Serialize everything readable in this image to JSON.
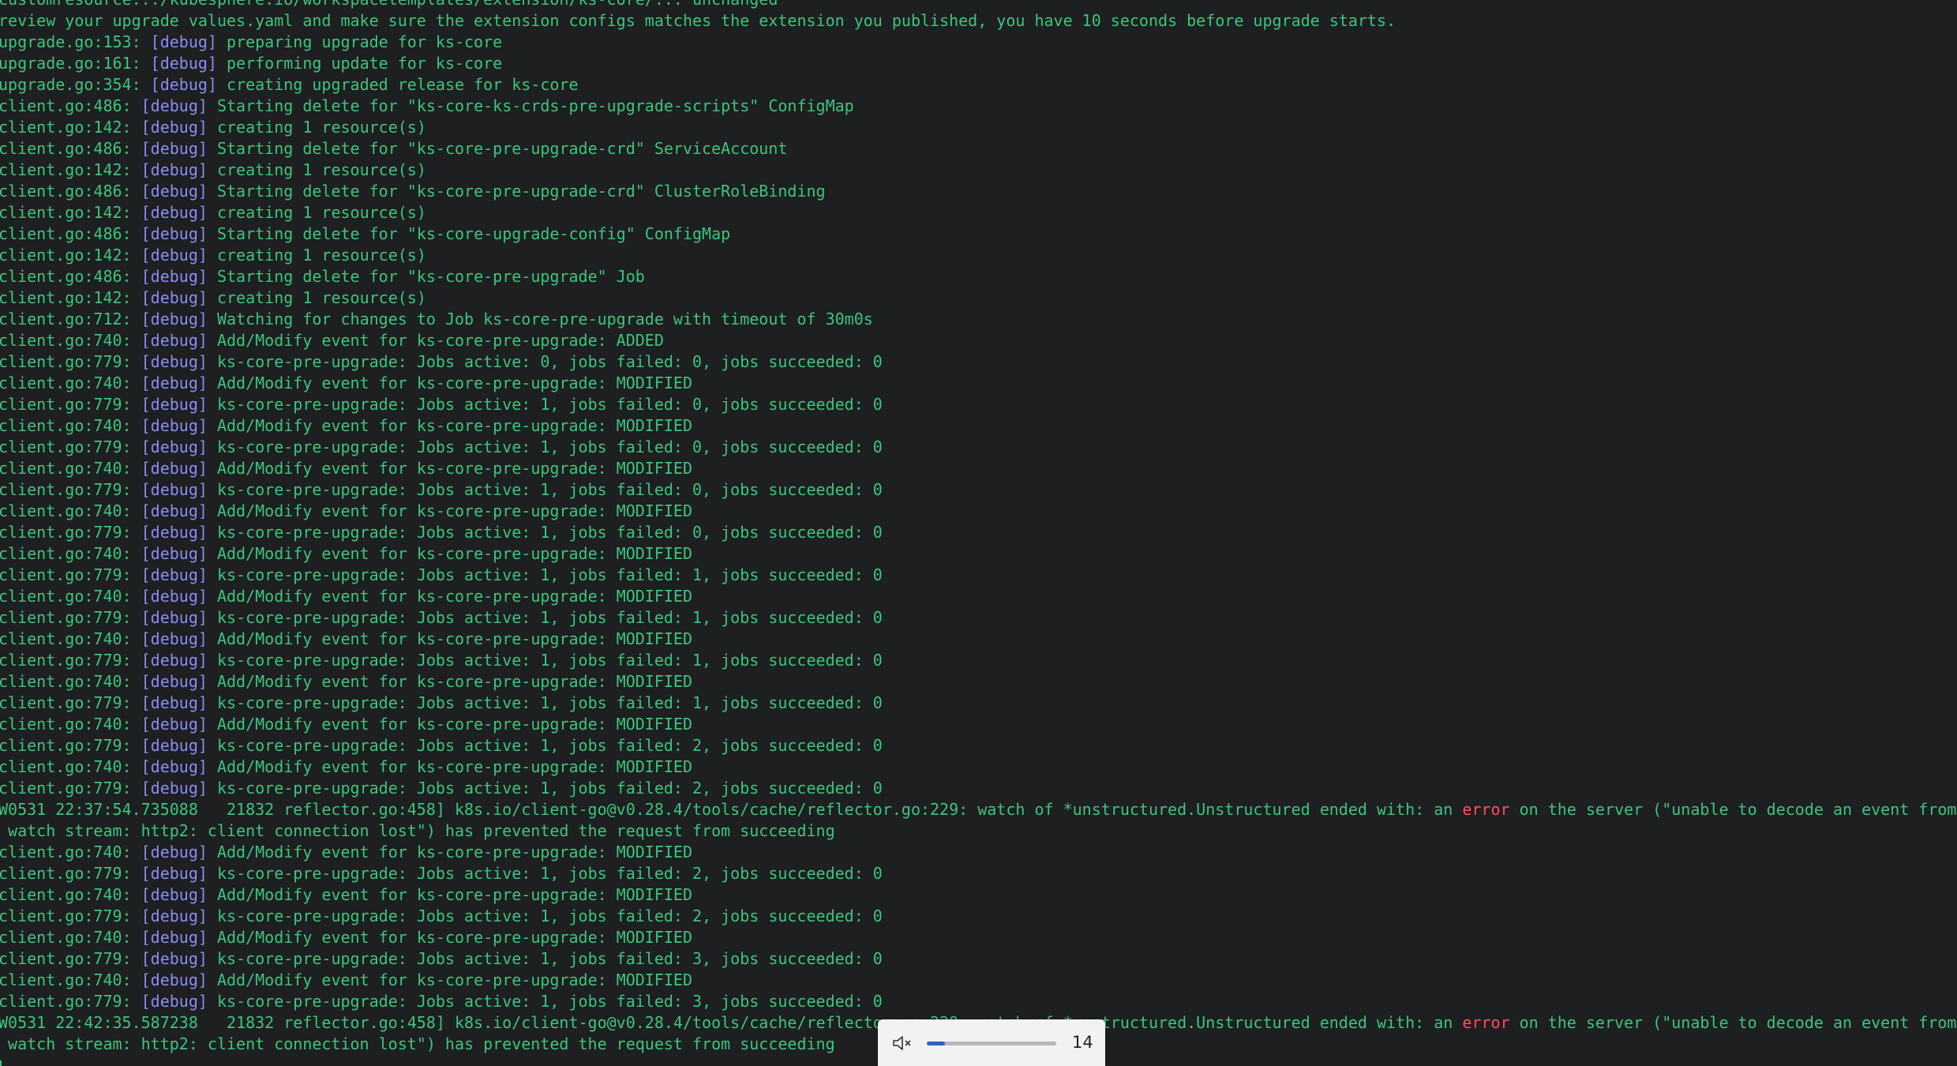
{
  "terminal": {
    "lines": [
      [
        {
          "t": "customresource.../kubesphere.io/workspacetemplates/extension/ks-core/... unchanged",
          "c": "n"
        }
      ],
      [
        {
          "t": "review your upgrade values.yaml and make sure the extension configs matches the extension you published, you have 10 seconds before upgrade starts.",
          "c": "n"
        }
      ],
      [
        {
          "t": "upgrade.go:153: ",
          "c": "n"
        },
        {
          "t": "[debug]",
          "c": "tag"
        },
        {
          "t": " preparing upgrade for ks-core",
          "c": "n"
        }
      ],
      [
        {
          "t": "upgrade.go:161: ",
          "c": "n"
        },
        {
          "t": "[debug]",
          "c": "tag"
        },
        {
          "t": " performing update for ks-core",
          "c": "n"
        }
      ],
      [
        {
          "t": "upgrade.go:354: ",
          "c": "n"
        },
        {
          "t": "[debug]",
          "c": "tag"
        },
        {
          "t": " creating upgraded release for ks-core",
          "c": "n"
        }
      ],
      [
        {
          "t": "client.go:486: ",
          "c": "n"
        },
        {
          "t": "[debug]",
          "c": "tag"
        },
        {
          "t": " Starting delete for \"ks-core-ks-crds-pre-upgrade-scripts\" ConfigMap",
          "c": "n"
        }
      ],
      [
        {
          "t": "client.go:142: ",
          "c": "n"
        },
        {
          "t": "[debug]",
          "c": "tag"
        },
        {
          "t": " creating 1 resource(s)",
          "c": "n"
        }
      ],
      [
        {
          "t": "client.go:486: ",
          "c": "n"
        },
        {
          "t": "[debug]",
          "c": "tag"
        },
        {
          "t": " Starting delete for \"ks-core-pre-upgrade-crd\" ServiceAccount",
          "c": "n"
        }
      ],
      [
        {
          "t": "client.go:142: ",
          "c": "n"
        },
        {
          "t": "[debug]",
          "c": "tag"
        },
        {
          "t": " creating 1 resource(s)",
          "c": "n"
        }
      ],
      [
        {
          "t": "client.go:486: ",
          "c": "n"
        },
        {
          "t": "[debug]",
          "c": "tag"
        },
        {
          "t": " Starting delete for \"ks-core-pre-upgrade-crd\" ClusterRoleBinding",
          "c": "n"
        }
      ],
      [
        {
          "t": "client.go:142: ",
          "c": "n"
        },
        {
          "t": "[debug]",
          "c": "tag"
        },
        {
          "t": " creating 1 resource(s)",
          "c": "n"
        }
      ],
      [
        {
          "t": "client.go:486: ",
          "c": "n"
        },
        {
          "t": "[debug]",
          "c": "tag"
        },
        {
          "t": " Starting delete for \"ks-core-upgrade-config\" ConfigMap",
          "c": "n"
        }
      ],
      [
        {
          "t": "client.go:142: ",
          "c": "n"
        },
        {
          "t": "[debug]",
          "c": "tag"
        },
        {
          "t": " creating 1 resource(s)",
          "c": "n"
        }
      ],
      [
        {
          "t": "client.go:486: ",
          "c": "n"
        },
        {
          "t": "[debug]",
          "c": "tag"
        },
        {
          "t": " Starting delete for \"ks-core-pre-upgrade\" Job",
          "c": "n"
        }
      ],
      [
        {
          "t": "client.go:142: ",
          "c": "n"
        },
        {
          "t": "[debug]",
          "c": "tag"
        },
        {
          "t": " creating 1 resource(s)",
          "c": "n"
        }
      ],
      [
        {
          "t": "client.go:712: ",
          "c": "n"
        },
        {
          "t": "[debug]",
          "c": "tag"
        },
        {
          "t": " Watching for changes to Job ks-core-pre-upgrade with timeout of 30m0s",
          "c": "n"
        }
      ],
      [
        {
          "t": "client.go:740: ",
          "c": "n"
        },
        {
          "t": "[debug]",
          "c": "tag"
        },
        {
          "t": " Add/Modify event for ks-core-pre-upgrade: ADDED",
          "c": "n"
        }
      ],
      [
        {
          "t": "client.go:779: ",
          "c": "n"
        },
        {
          "t": "[debug]",
          "c": "tag"
        },
        {
          "t": " ks-core-pre-upgrade: Jobs active: 0, jobs failed: 0, jobs succeeded: 0",
          "c": "n"
        }
      ],
      [
        {
          "t": "client.go:740: ",
          "c": "n"
        },
        {
          "t": "[debug]",
          "c": "tag"
        },
        {
          "t": " Add/Modify event for ks-core-pre-upgrade: MODIFIED",
          "c": "n"
        }
      ],
      [
        {
          "t": "client.go:779: ",
          "c": "n"
        },
        {
          "t": "[debug]",
          "c": "tag"
        },
        {
          "t": " ks-core-pre-upgrade: Jobs active: 1, jobs failed: 0, jobs succeeded: 0",
          "c": "n"
        }
      ],
      [
        {
          "t": "client.go:740: ",
          "c": "n"
        },
        {
          "t": "[debug]",
          "c": "tag"
        },
        {
          "t": " Add/Modify event for ks-core-pre-upgrade: MODIFIED",
          "c": "n"
        }
      ],
      [
        {
          "t": "client.go:779: ",
          "c": "n"
        },
        {
          "t": "[debug]",
          "c": "tag"
        },
        {
          "t": " ks-core-pre-upgrade: Jobs active: 1, jobs failed: 0, jobs succeeded: 0",
          "c": "n"
        }
      ],
      [
        {
          "t": "client.go:740: ",
          "c": "n"
        },
        {
          "t": "[debug]",
          "c": "tag"
        },
        {
          "t": " Add/Modify event for ks-core-pre-upgrade: MODIFIED",
          "c": "n"
        }
      ],
      [
        {
          "t": "client.go:779: ",
          "c": "n"
        },
        {
          "t": "[debug]",
          "c": "tag"
        },
        {
          "t": " ks-core-pre-upgrade: Jobs active: 1, jobs failed: 0, jobs succeeded: 0",
          "c": "n"
        }
      ],
      [
        {
          "t": "client.go:740: ",
          "c": "n"
        },
        {
          "t": "[debug]",
          "c": "tag"
        },
        {
          "t": " Add/Modify event for ks-core-pre-upgrade: MODIFIED",
          "c": "n"
        }
      ],
      [
        {
          "t": "client.go:779: ",
          "c": "n"
        },
        {
          "t": "[debug]",
          "c": "tag"
        },
        {
          "t": " ks-core-pre-upgrade: Jobs active: 1, jobs failed: 0, jobs succeeded: 0",
          "c": "n"
        }
      ],
      [
        {
          "t": "client.go:740: ",
          "c": "n"
        },
        {
          "t": "[debug]",
          "c": "tag"
        },
        {
          "t": " Add/Modify event for ks-core-pre-upgrade: MODIFIED",
          "c": "n"
        }
      ],
      [
        {
          "t": "client.go:779: ",
          "c": "n"
        },
        {
          "t": "[debug]",
          "c": "tag"
        },
        {
          "t": " ks-core-pre-upgrade: Jobs active: 1, jobs failed: 1, jobs succeeded: 0",
          "c": "n"
        }
      ],
      [
        {
          "t": "client.go:740: ",
          "c": "n"
        },
        {
          "t": "[debug]",
          "c": "tag"
        },
        {
          "t": " Add/Modify event for ks-core-pre-upgrade: MODIFIED",
          "c": "n"
        }
      ],
      [
        {
          "t": "client.go:779: ",
          "c": "n"
        },
        {
          "t": "[debug]",
          "c": "tag"
        },
        {
          "t": " ks-core-pre-upgrade: Jobs active: 1, jobs failed: 1, jobs succeeded: 0",
          "c": "n"
        }
      ],
      [
        {
          "t": "client.go:740: ",
          "c": "n"
        },
        {
          "t": "[debug]",
          "c": "tag"
        },
        {
          "t": " Add/Modify event for ks-core-pre-upgrade: MODIFIED",
          "c": "n"
        }
      ],
      [
        {
          "t": "client.go:779: ",
          "c": "n"
        },
        {
          "t": "[debug]",
          "c": "tag"
        },
        {
          "t": " ks-core-pre-upgrade: Jobs active: 1, jobs failed: 1, jobs succeeded: 0",
          "c": "n"
        }
      ],
      [
        {
          "t": "client.go:740: ",
          "c": "n"
        },
        {
          "t": "[debug]",
          "c": "tag"
        },
        {
          "t": " Add/Modify event for ks-core-pre-upgrade: MODIFIED",
          "c": "n"
        }
      ],
      [
        {
          "t": "client.go:779: ",
          "c": "n"
        },
        {
          "t": "[debug]",
          "c": "tag"
        },
        {
          "t": " ks-core-pre-upgrade: Jobs active: 1, jobs failed: 1, jobs succeeded: 0",
          "c": "n"
        }
      ],
      [
        {
          "t": "client.go:740: ",
          "c": "n"
        },
        {
          "t": "[debug]",
          "c": "tag"
        },
        {
          "t": " Add/Modify event for ks-core-pre-upgrade: MODIFIED",
          "c": "n"
        }
      ],
      [
        {
          "t": "client.go:779: ",
          "c": "n"
        },
        {
          "t": "[debug]",
          "c": "tag"
        },
        {
          "t": " ks-core-pre-upgrade: Jobs active: 1, jobs failed: 2, jobs succeeded: 0",
          "c": "n"
        }
      ],
      [
        {
          "t": "client.go:740: ",
          "c": "n"
        },
        {
          "t": "[debug]",
          "c": "tag"
        },
        {
          "t": " Add/Modify event for ks-core-pre-upgrade: MODIFIED",
          "c": "n"
        }
      ],
      [
        {
          "t": "client.go:779: ",
          "c": "n"
        },
        {
          "t": "[debug]",
          "c": "tag"
        },
        {
          "t": " ks-core-pre-upgrade: Jobs active: 1, jobs failed: 2, jobs succeeded: 0",
          "c": "n"
        }
      ],
      [
        {
          "t": "W0531 22:37:54.735088   21832 reflector.go:458] k8s.io/client-go@v0.28.4/tools/cache/reflector.go:229: watch of *unstructured.Unstructured ended with: an ",
          "c": "n"
        },
        {
          "t": "error",
          "c": "err"
        },
        {
          "t": " on the server (\"unable to decode an event from",
          "c": "n"
        }
      ],
      [
        {
          "t": " watch stream: http2: client connection lost\") has prevented the request from succeeding",
          "c": "n"
        }
      ],
      [
        {
          "t": "client.go:740: ",
          "c": "n"
        },
        {
          "t": "[debug]",
          "c": "tag"
        },
        {
          "t": " Add/Modify event for ks-core-pre-upgrade: MODIFIED",
          "c": "n"
        }
      ],
      [
        {
          "t": "client.go:779: ",
          "c": "n"
        },
        {
          "t": "[debug]",
          "c": "tag"
        },
        {
          "t": " ks-core-pre-upgrade: Jobs active: 1, jobs failed: 2, jobs succeeded: 0",
          "c": "n"
        }
      ],
      [
        {
          "t": "client.go:740: ",
          "c": "n"
        },
        {
          "t": "[debug]",
          "c": "tag"
        },
        {
          "t": " Add/Modify event for ks-core-pre-upgrade: MODIFIED",
          "c": "n"
        }
      ],
      [
        {
          "t": "client.go:779: ",
          "c": "n"
        },
        {
          "t": "[debug]",
          "c": "tag"
        },
        {
          "t": " ks-core-pre-upgrade: Jobs active: 1, jobs failed: 2, jobs succeeded: 0",
          "c": "n"
        }
      ],
      [
        {
          "t": "client.go:740: ",
          "c": "n"
        },
        {
          "t": "[debug]",
          "c": "tag"
        },
        {
          "t": " Add/Modify event for ks-core-pre-upgrade: MODIFIED",
          "c": "n"
        }
      ],
      [
        {
          "t": "client.go:779: ",
          "c": "n"
        },
        {
          "t": "[debug]",
          "c": "tag"
        },
        {
          "t": " ks-core-pre-upgrade: Jobs active: 1, jobs failed: 3, jobs succeeded: 0",
          "c": "n"
        }
      ],
      [
        {
          "t": "client.go:740: ",
          "c": "n"
        },
        {
          "t": "[debug]",
          "c": "tag"
        },
        {
          "t": " Add/Modify event for ks-core-pre-upgrade: MODIFIED",
          "c": "n"
        }
      ],
      [
        {
          "t": "client.go:779: ",
          "c": "n"
        },
        {
          "t": "[debug]",
          "c": "tag"
        },
        {
          "t": " ks-core-pre-upgrade: Jobs active: 1, jobs failed: 3, jobs succeeded: 0",
          "c": "n"
        }
      ],
      [
        {
          "t": "W0531 22:42:35.587238   21832 reflector.go:458] k8s.io/client-go@v0.28.4/tools/cache/reflector.go:229: watch of *unstructured.Unstructured ended with: an ",
          "c": "n"
        },
        {
          "t": "error",
          "c": "err"
        },
        {
          "t": " on the server (\"unable to decode an event from",
          "c": "n"
        }
      ],
      [
        {
          "t": " watch stream: http2: client connection lost\") has prevented the request from succeeding",
          "c": "n"
        }
      ]
    ]
  },
  "volume_osd": {
    "icon": "speaker-muted-icon",
    "level": 14,
    "level_label": "14",
    "max": 100
  },
  "colors": {
    "background": "#1d1f21",
    "text": "#3ec47c",
    "debug_tag": "#8a8cf2",
    "error": "#ff4d5a",
    "osd_background": "#f2f2f2",
    "osd_fill": "#2a64c6"
  }
}
